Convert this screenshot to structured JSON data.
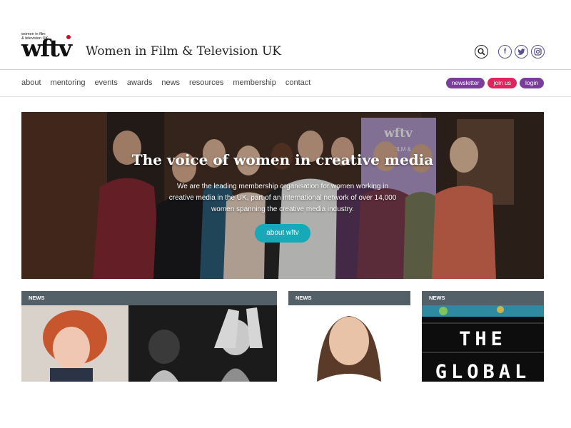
{
  "logo": {
    "small_text_line1": "women in film",
    "small_text_line2": "& television UK",
    "wordmark": "wftv",
    "org_name": "Women in Film & Television UK"
  },
  "header_icons": {
    "search": "search-icon",
    "facebook": "f",
    "twitter": "twitter-icon",
    "instagram": "instagram-icon"
  },
  "nav": [
    "about",
    "mentoring",
    "events",
    "awards",
    "news",
    "resources",
    "membership",
    "contact"
  ],
  "actions": {
    "newsletter": "newsletter",
    "join": "join us",
    "login": "login"
  },
  "hero": {
    "title": "The voice of women in creative media",
    "subtitle": "We are the leading membership organisation for women working in creative media in the UK, part of an international network of over 14,000 women spanning the creative media industry.",
    "button": "about wftv",
    "banner_text_1": "wftv",
    "banner_text_2": "IN FILM &"
  },
  "cards": [
    {
      "tag": "NEWS"
    },
    {
      "tag": "NEWS"
    },
    {
      "tag": "NEWS",
      "image_text_1": "THE",
      "image_text_2": "GLOBAL"
    }
  ],
  "colors": {
    "purple": "#7a3d99",
    "pink": "#e0245e",
    "teal_button": "#16a9b7",
    "card_bar": "#546068"
  }
}
